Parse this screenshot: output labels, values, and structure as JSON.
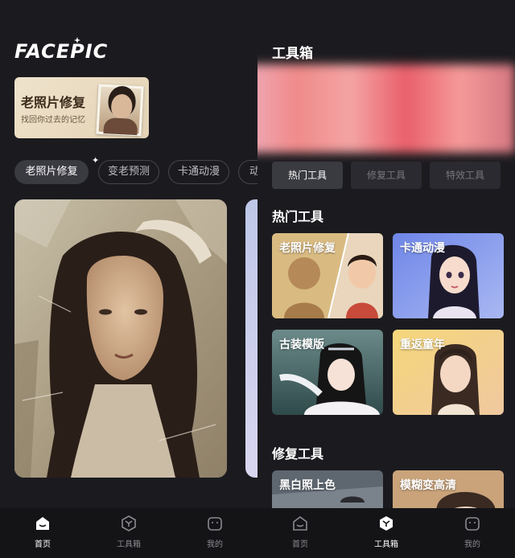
{
  "left": {
    "logo": "FACEPIC",
    "banner": {
      "title": "老照片修复",
      "subtitle": "找回你过去的记忆"
    },
    "chips": [
      "老照片修复",
      "变老预测",
      "卡通动漫",
      "动"
    ],
    "active_chip": "老照片修复"
  },
  "right": {
    "header_title": "工具箱",
    "segments": [
      "热门工具",
      "修复工具",
      "特效工具"
    ],
    "active_segment": "热门工具",
    "hot_section_title": "热门工具",
    "hot_tools": [
      "老照片修复",
      "卡通动漫",
      "古装模版",
      "重返童年"
    ],
    "repair_section_title": "修复工具",
    "repair_tools": [
      "黑白照上色",
      "模糊变高清"
    ]
  },
  "tabbar": {
    "items": [
      {
        "label": "首页",
        "icon": "home-icon"
      },
      {
        "label": "工具箱",
        "icon": "toolbox-icon"
      },
      {
        "label": "我的",
        "icon": "profile-icon"
      }
    ]
  },
  "colors": {
    "background": "#1b1b1f",
    "tabbar": "#141417",
    "chip_active": "#3a3a41",
    "accent_text": "#ffffff"
  }
}
